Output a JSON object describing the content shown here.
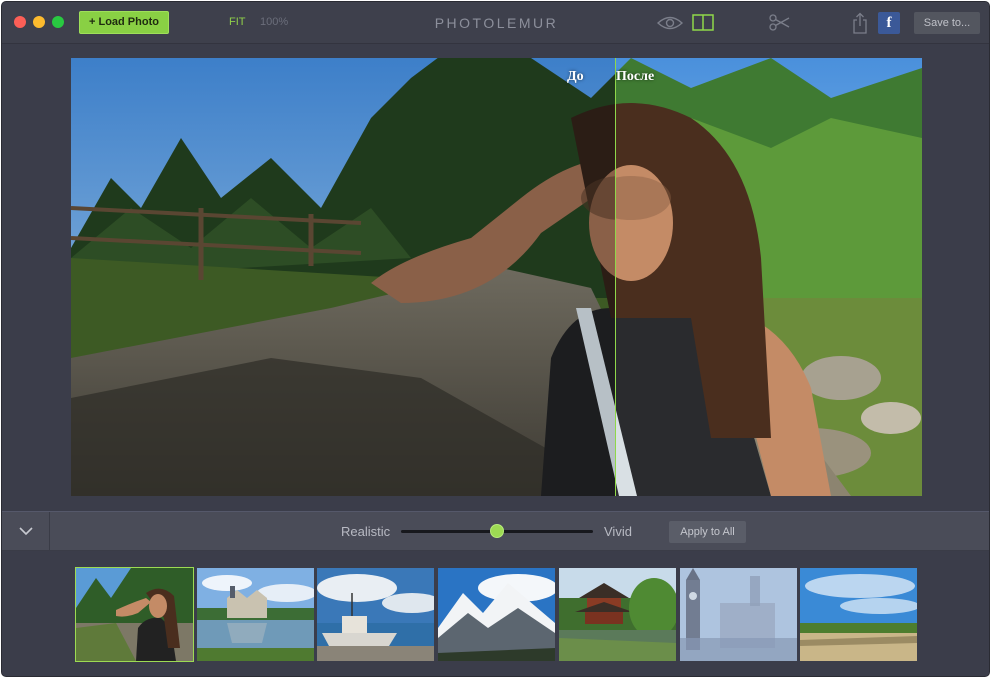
{
  "titlebar": {
    "load_button": "+ Load Photo",
    "zoom_fit": "FIT",
    "zoom_percent": "100%",
    "app_title": "PHOTOLEMUR",
    "save_button": "Save to...",
    "facebook_label": "f"
  },
  "photo": {
    "before_label": "До",
    "after_label": "После",
    "divider_position": 0.64
  },
  "controls": {
    "left_label": "Realistic",
    "right_label": "Vivid",
    "slider_value": 0.5,
    "apply_button": "Apply to All"
  },
  "thumbnails": [
    {
      "name": "woman-on-trail",
      "selected": true
    },
    {
      "name": "castle-lake",
      "selected": false
    },
    {
      "name": "boat-harbor",
      "selected": false
    },
    {
      "name": "snowy-mountains",
      "selected": false
    },
    {
      "name": "pagoda-garden",
      "selected": false
    },
    {
      "name": "foggy-city",
      "selected": false
    },
    {
      "name": "sky-field",
      "selected": false
    }
  ],
  "colors": {
    "accent": "#89d044",
    "background": "#3b3d4a",
    "facebook": "#3b5998"
  }
}
